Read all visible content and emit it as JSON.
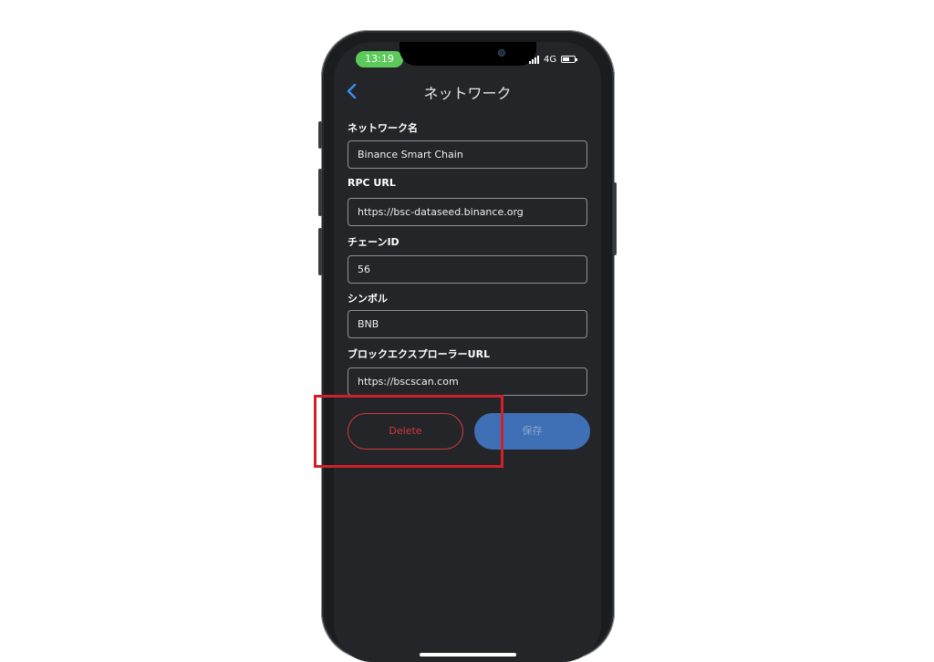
{
  "status": {
    "time": "13:19",
    "network": "4G"
  },
  "nav": {
    "title": "ネットワーク"
  },
  "form": {
    "fields": [
      {
        "label": "ネットワーク名",
        "value": "Binance Smart Chain"
      },
      {
        "label": "RPC URL",
        "value": "https://bsc-dataseed.binance.org"
      },
      {
        "label": "チェーンID",
        "value": "56"
      },
      {
        "label": "シンボル",
        "value": "BNB"
      },
      {
        "label": "ブロックエクスプローラーURL",
        "value": "https://bscscan.com"
      }
    ]
  },
  "actions": {
    "delete_label": "Delete",
    "save_label": "保存"
  },
  "colors": {
    "delete": "#d0393f",
    "save": "#3f6fb4",
    "highlight": "#d0202a",
    "time_pill": "#5cc95a"
  },
  "icons": {
    "back": "chevron-left-icon",
    "signal": "signal-bars-icon",
    "battery": "battery-icon"
  }
}
